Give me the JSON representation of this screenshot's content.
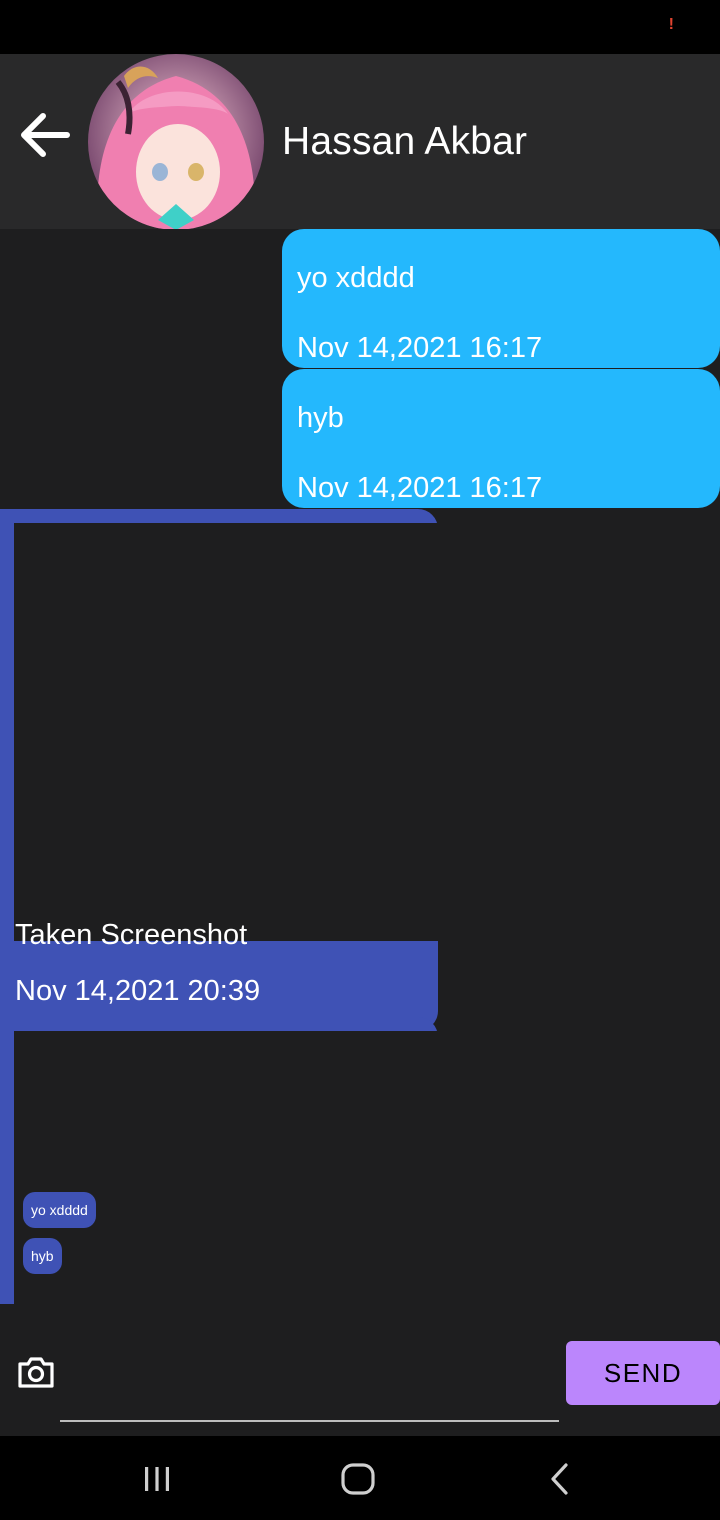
{
  "status_bar": {
    "alert_glyph": "!",
    "alert_color": "#e0432f"
  },
  "header": {
    "contact_name": "Hassan Akbar",
    "back_icon": "arrow-left-icon",
    "avatar_desc_icon": "avatar"
  },
  "messages": [
    {
      "direction": "outgoing",
      "text": "yo xdddd",
      "time": "Nov 14,2021 16:17"
    },
    {
      "direction": "outgoing",
      "text": "hyb",
      "time": "Nov 14,2021 16:17"
    },
    {
      "direction": "incoming",
      "type": "image",
      "caption": "Taken Screenshot",
      "time": "Nov 14,2021 20:39"
    },
    {
      "direction": "incoming",
      "type": "image",
      "preview_chips": [
        "yo xdddd",
        "hyb"
      ]
    }
  ],
  "composer": {
    "input_value": "",
    "input_placeholder": "",
    "send_label": "SEND",
    "camera_icon": "camera-icon"
  },
  "nav_bar": {
    "recents_icon": "recents-icon",
    "home_icon": "home-icon",
    "back_icon": "nav-back-icon"
  },
  "colors": {
    "outgoing_bubble": "#24b8fd",
    "incoming_card": "#3f52b5",
    "send_button": "#bb86fc",
    "chat_background": "#1e1e1f",
    "header_background": "#29292a"
  }
}
